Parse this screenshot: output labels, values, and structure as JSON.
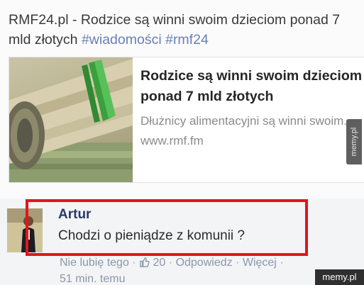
{
  "post": {
    "text_line1": "RMF24.pl - Rodzice są winni swoim dzieciom ponad 7",
    "text_line2_prefix": "mld złotych",
    "hashtag1": "#wiadomości",
    "hashtag2": "#rmf24"
  },
  "link_card": {
    "title_line1": "Rodzice są winni swoim dzieciom",
    "title_line2": "ponad 7 mld złotych",
    "description": "Dłużnicy alimentacyjni są winni swoim...",
    "domain": "www.rmf.fm"
  },
  "comment": {
    "author": "Artur",
    "text": "Chodzi o pieniądze z komunii ?",
    "action_unlike": "Nie lubię tego",
    "like_count": "20",
    "action_reply": "Odpowiedz",
    "action_more": "Więcej",
    "time": "51 min. temu"
  },
  "watermarks": {
    "side": "memy.pl",
    "bottom": "memy.pl"
  },
  "colors": {
    "highlight": "#e0161a",
    "hashtag": "#6a7fb4",
    "author": "#2b3a63"
  }
}
